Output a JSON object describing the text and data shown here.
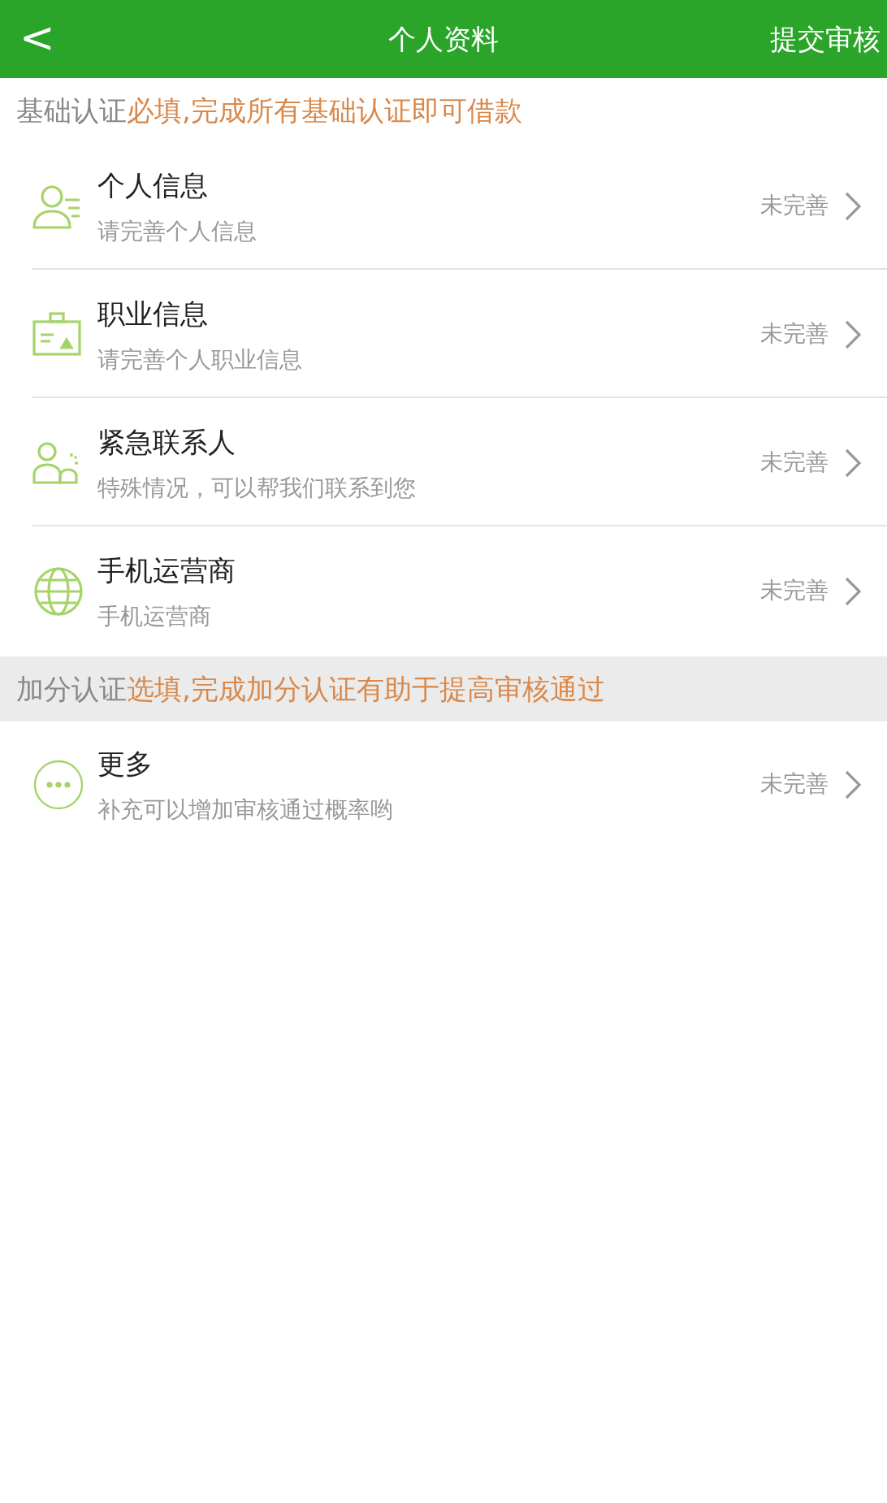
{
  "header": {
    "back": "<",
    "title": "个人资料",
    "action": "提交审核"
  },
  "sections": [
    {
      "label": "基础认证",
      "note": "必填,完成所有基础认证即可借款",
      "shaded": false,
      "items": [
        {
          "kind": "person",
          "title": "个人信息",
          "subtitle": "请完善个人信息",
          "status": "未完善"
        },
        {
          "kind": "badge",
          "title": "职业信息",
          "subtitle": "请完善个人职业信息",
          "status": "未完善"
        },
        {
          "kind": "contact",
          "title": "紧急联系人",
          "subtitle": "特殊情况，可以帮我们联系到您",
          "status": "未完善"
        },
        {
          "kind": "globe",
          "title": "手机运营商",
          "subtitle": "手机运营商",
          "status": "未完善"
        }
      ]
    },
    {
      "label": "加分认证",
      "note": "选填,完成加分认证有助于提高审核通过",
      "shaded": true,
      "items": [
        {
          "kind": "more",
          "title": "更多",
          "subtitle": "补充可以增加审核通过概率哟",
          "status": "未完善"
        }
      ]
    }
  ]
}
